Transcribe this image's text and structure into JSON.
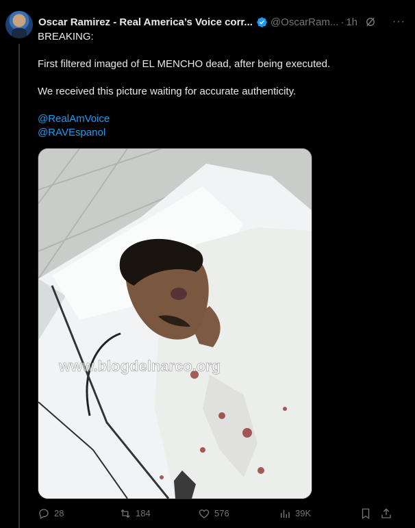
{
  "post": {
    "author_name": "Oscar Ramirez - Real America’s Voice corr...",
    "handle": "@OscarRam...",
    "separator": "·",
    "time": "1h",
    "more": "···",
    "text": {
      "line1": "BREAKING:",
      "line2": "First filtered imaged of EL MENCHO dead, after being executed.",
      "line3": "We received this picture waiting for accurate authenticity.",
      "mention1": "@RealAmVoice",
      "mention2": "@RAVEspanol"
    },
    "image": {
      "watermark": "www.blogdelnarco.org"
    }
  },
  "actions": {
    "replies": "28",
    "reposts": "184",
    "likes": "576",
    "views": "39K"
  },
  "colors": {
    "background": "#000000",
    "text": "#e7e9ea",
    "muted": "#71767b",
    "accent": "#1d9bf0"
  }
}
